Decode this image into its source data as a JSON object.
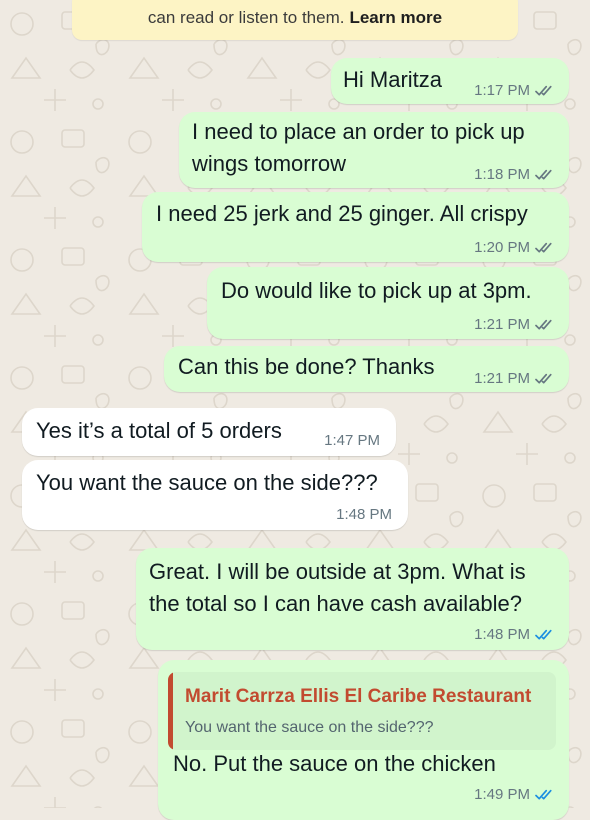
{
  "notice": {
    "text": "can read or listen to them.",
    "link": "Learn more"
  },
  "messages": [
    {
      "direction": "outgoing",
      "text": "Hi Maritza",
      "time": "1:17 PM",
      "status": "read"
    },
    {
      "direction": "outgoing",
      "text": "I need to place an order to pick up\nwings tomorrow",
      "time": "1:18 PM",
      "status": "read"
    },
    {
      "direction": "outgoing",
      "text": "I need 25 jerk and 25 ginger. All crispy",
      "time": "1:20 PM",
      "status": "read"
    },
    {
      "direction": "outgoing",
      "text": "Do would like to pick up at 3pm.",
      "time": "1:21 PM",
      "status": "read"
    },
    {
      "direction": "outgoing",
      "text": "Can this be done? Thanks",
      "time": "1:21 PM",
      "status": "read"
    },
    {
      "direction": "incoming",
      "text": "Yes it’s a total of 5 orders",
      "time": "1:47 PM"
    },
    {
      "direction": "incoming",
      "text": "You want the sauce on the side???",
      "time": "1:48 PM"
    },
    {
      "direction": "outgoing",
      "text": "Great. I will be outside at 3pm. What is\nthe total so I can have cash available?",
      "time": "1:48 PM",
      "status": "read"
    },
    {
      "direction": "outgoing",
      "text": "No. Put the sauce on the chicken",
      "time": "1:49 PM",
      "status": "read",
      "reply_to": {
        "author": "Marit Carrza Ellis El Caribe Restaurant",
        "text": "You want the sauce on the side???"
      }
    }
  ],
  "colors": {
    "outgoing_bubble": "#d9fdd3",
    "incoming_bubble": "#ffffff",
    "chat_background": "#efeae2",
    "read_ticks": "#1d8fe1",
    "quote_author": "#c24b30"
  },
  "icons": {
    "status_read": "double-check-icon"
  }
}
